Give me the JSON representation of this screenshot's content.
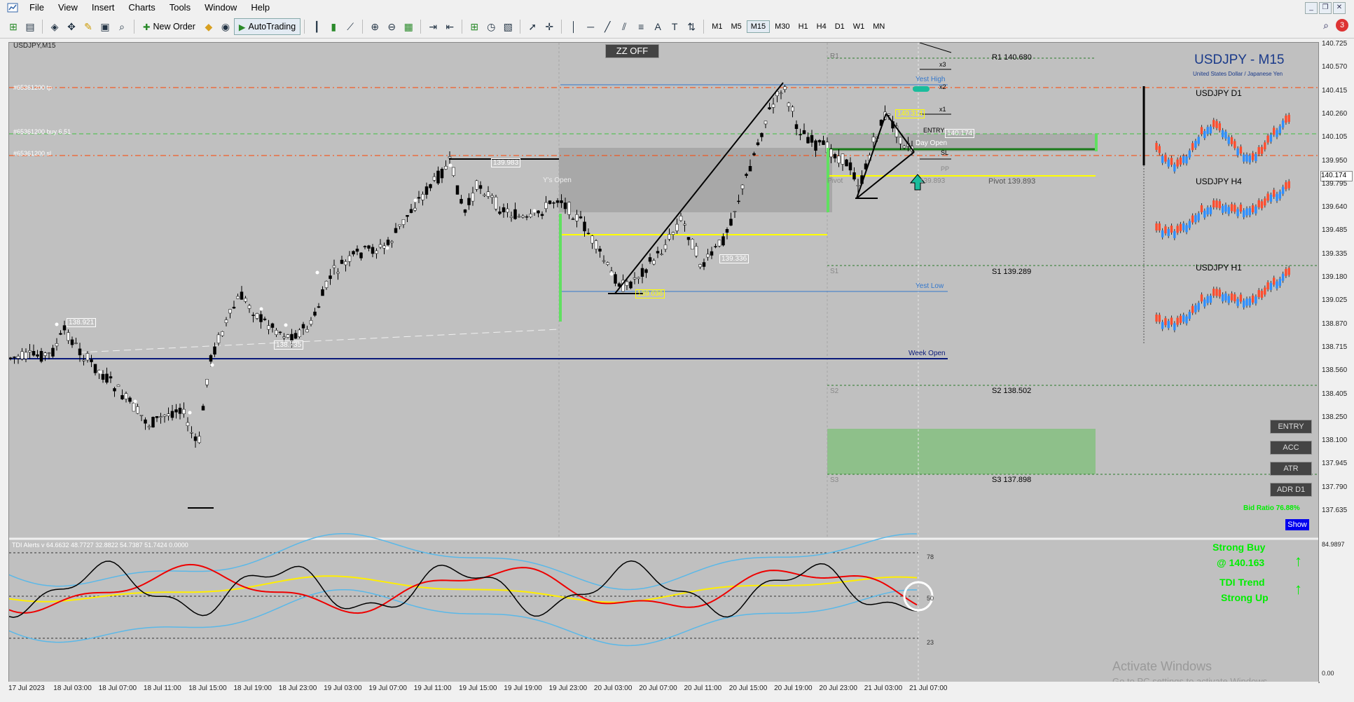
{
  "menu": [
    "File",
    "View",
    "Insert",
    "Charts",
    "Tools",
    "Window",
    "Help"
  ],
  "toolbar": {
    "new_order": "New Order",
    "autotrading": "AutoTrading",
    "timeframes": [
      "M1",
      "M5",
      "M15",
      "M30",
      "H1",
      "H4",
      "D1",
      "W1",
      "MN"
    ],
    "active_timeframe": "M15",
    "notifications": "3"
  },
  "chart": {
    "symbol_label": "USDJPY,M15",
    "title": "USDJPY - M15",
    "subtitle": "United States Dollar / Japanese Yen",
    "zz_button": "ZZ OFF",
    "order_labels": {
      "tp": "#65361200 tp",
      "buy": "#65361200 buy 6.51",
      "sl": "#65361200 sl"
    },
    "levels": {
      "r1": "R1 140.680",
      "pivot": "Pivot 139.893",
      "s1": "S1 139.289",
      "s2": "S2 138.502",
      "s3": "S3 137.898"
    },
    "level_markers": {
      "r1": "R1",
      "pivot": "Pivot",
      "s1": "S1",
      "s2": "S2",
      "s3": "S3"
    },
    "text_labels": {
      "yest_high": "Yest High",
      "yest_low": "Yest Low",
      "week_open": "Week Open",
      "day_open": "Day Open",
      "ys_open": "Y's Open",
      "entry": "ENTRY",
      "sl_short": "SL",
      "pp": "PP",
      "x3": "x3",
      "x2": "x2",
      "x1": "x1",
      "pivot_val": "139.893"
    },
    "price_tags": {
      "p138921": "138.921",
      "p138735": "138.735",
      "p139983": "139.983",
      "p139336": "139.336",
      "p139036": "139.036",
      "p140314": "140.314",
      "p140174": "140.174"
    },
    "mini_charts": [
      "USDJPY D1",
      "USDJPY H4",
      "USDJPY H1"
    ],
    "buttons": {
      "entry": "ENTRY",
      "acc": "ACC",
      "atr": "ATR",
      "adr": "ADR D1",
      "show": "Show"
    },
    "bid_ratio": "Bid Ratio 76.88%",
    "signal": {
      "line1": "Strong Buy",
      "line2": "@ 140.163",
      "line3": "TDI Trend",
      "line4": "Strong Up"
    },
    "watermark": {
      "line1": "Activate Windows",
      "line2": "Go to PC settings to activate Windows."
    }
  },
  "indicator": {
    "label": "TDI Alerts v 64.6632 48.7727 32.8822 54.7387 51.7424 0.0000",
    "level_78": "78",
    "level_50": "50",
    "level_23": "23",
    "axis_top": "84.9897",
    "axis_bottom": "0.00"
  },
  "price_axis": [
    "140.725",
    "140.570",
    "140.415",
    "140.260",
    "140.105",
    "139.950",
    "139.795",
    "139.640",
    "139.485",
    "139.335",
    "139.180",
    "139.025",
    "138.870",
    "138.715",
    "138.560",
    "138.405",
    "138.250",
    "138.100",
    "137.945",
    "137.790",
    "137.635"
  ],
  "current_price": "140.174",
  "time_axis": [
    "17 Jul 2023",
    "18 Jul 03:00",
    "18 Jul 07:00",
    "18 Jul 11:00",
    "18 Jul 15:00",
    "18 Jul 19:00",
    "18 Jul 23:00",
    "19 Jul 03:00",
    "19 Jul 07:00",
    "19 Jul 11:00",
    "19 Jul 15:00",
    "19 Jul 19:00",
    "19 Jul 23:00",
    "20 Jul 03:00",
    "20 Jul 07:00",
    "20 Jul 11:00",
    "20 Jul 15:00",
    "20 Jul 19:00",
    "20 Jul 23:00",
    "21 Jul 03:00",
    "21 Jul 07:00"
  ],
  "colors": {
    "chart_bg": "#c0c0c0",
    "buy": "#2f8fff",
    "sell": "#ff4d2e",
    "tp_sl": "#ff4400",
    "entry": "#40c040",
    "pivot": "#ffff00",
    "signal": "#00ee00"
  }
}
